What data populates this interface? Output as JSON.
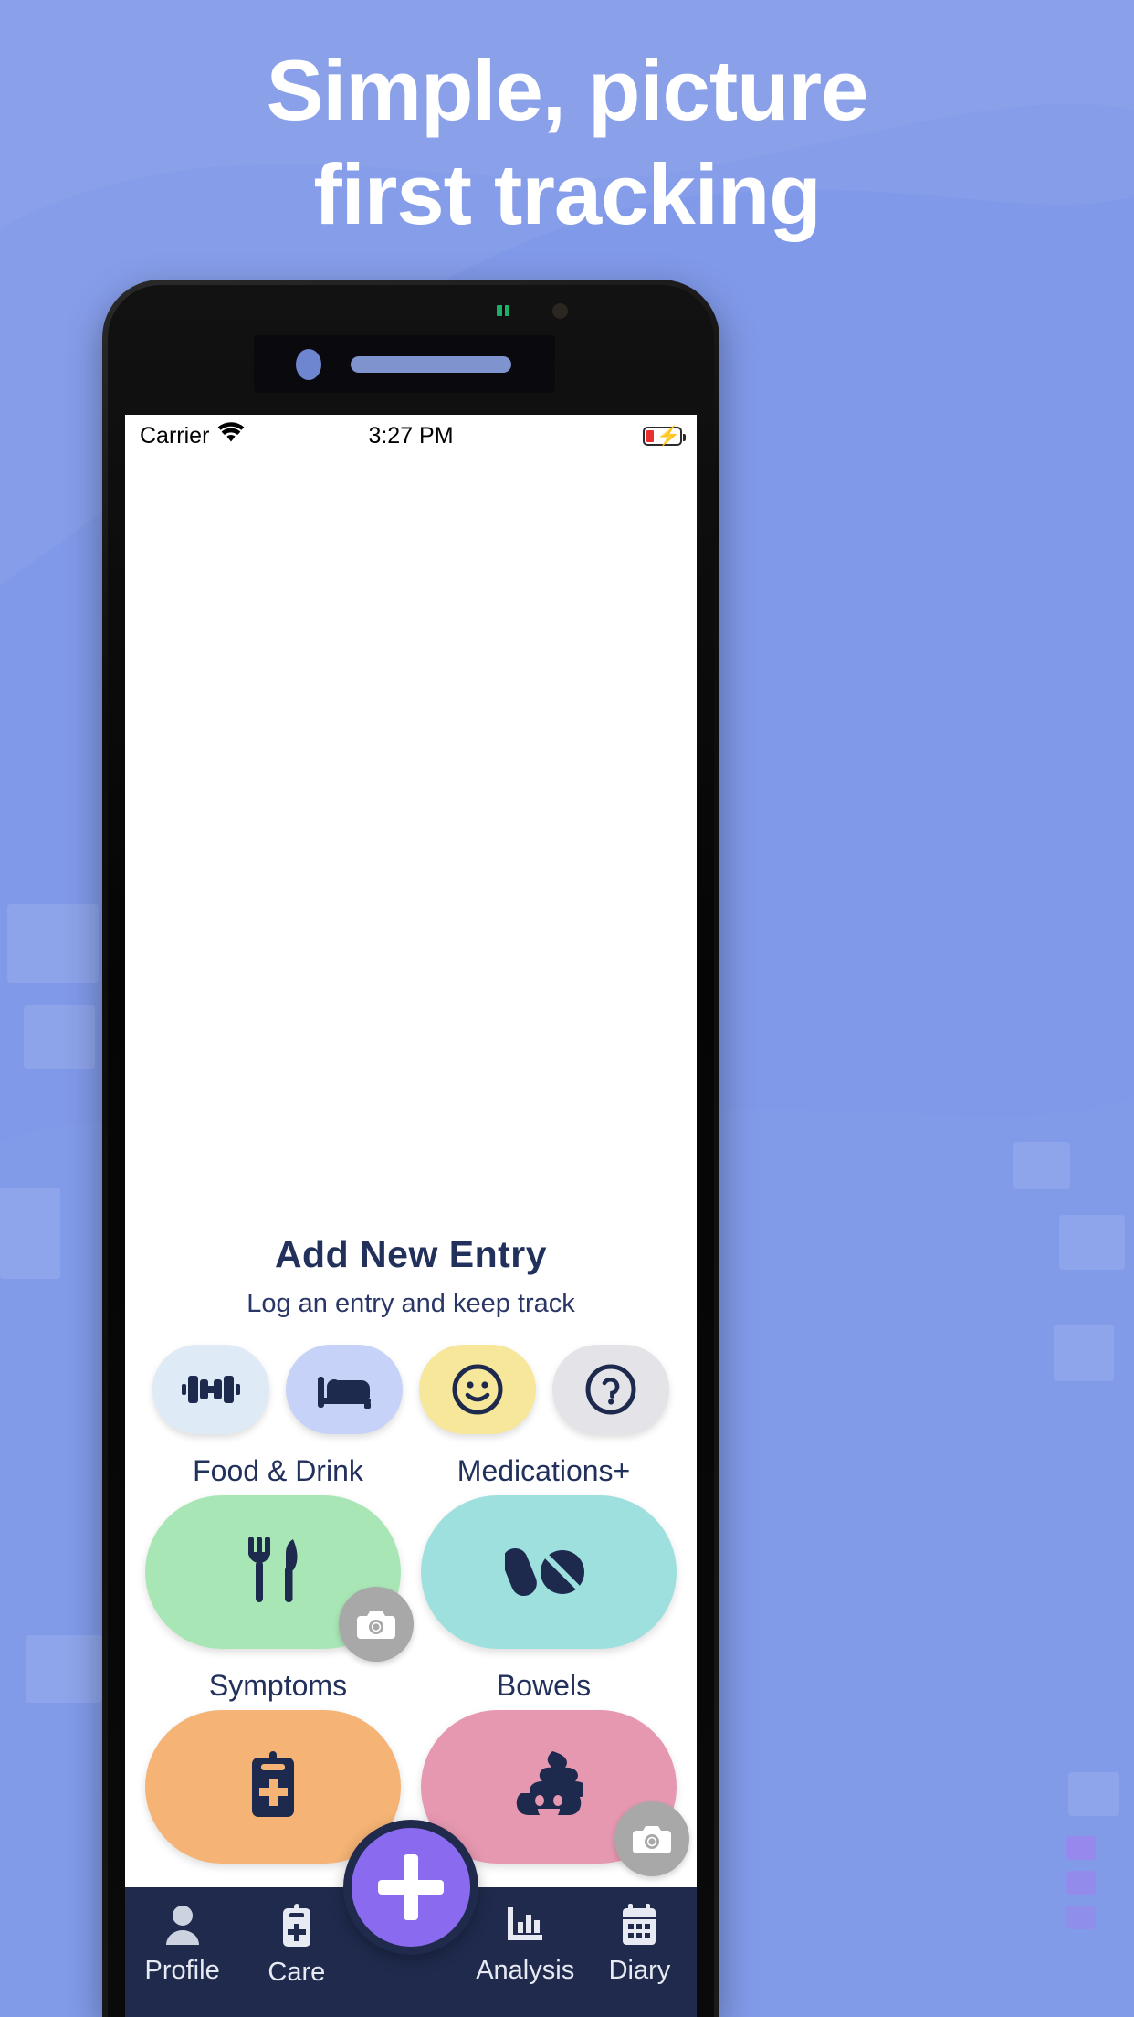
{
  "page": {
    "headline_line1": "Simple, picture",
    "headline_line2": "first tracking",
    "background_color": "#8099e8",
    "headline_color": "#ffffff"
  },
  "phone": {
    "status_bar": {
      "carrier": "Carrier",
      "wifi_icon": "wifi-icon",
      "time": "3:27 PM",
      "battery_icon": "battery-charging-low-icon"
    }
  },
  "app": {
    "title": "Add New Entry",
    "subtitle": "Log an entry and keep track",
    "accent_color": "#8a6bf0",
    "text_color": "#22305c",
    "quick_actions": [
      {
        "name": "exercise",
        "icon": "dumbbell-icon",
        "color": "#dfeaf7"
      },
      {
        "name": "sleep",
        "icon": "bed-icon",
        "color": "#c6d2f7"
      },
      {
        "name": "mood",
        "icon": "smiley-face-icon",
        "color": "#f7e79a"
      },
      {
        "name": "other",
        "icon": "question-mark-circle-icon",
        "color": "#e4e4e8"
      }
    ],
    "cards": [
      {
        "label": "Food & Drink",
        "icon": "fork-knife-icon",
        "color": "#a9e6b6",
        "camera_badge": true,
        "camera_icon": "camera-icon"
      },
      {
        "label": "Medications+",
        "icon": "pills-capsule-icon",
        "color": "#9de0dd",
        "camera_badge": false,
        "camera_icon": "camera-icon"
      },
      {
        "label": "Symptoms",
        "icon": "clipboard-medical-icon",
        "color": "#f5b375",
        "camera_badge": false,
        "camera_icon": "camera-icon"
      },
      {
        "label": "Bowels",
        "icon": "poop-icon",
        "color": "#e698b0",
        "camera_badge": true,
        "camera_icon": "camera-icon"
      }
    ],
    "tabbar": {
      "background_color": "#1f2a4d",
      "items": [
        {
          "label": "Profile",
          "icon": "person-icon"
        },
        {
          "label": "Care",
          "icon": "clipboard-medical-icon"
        },
        {
          "label": "",
          "icon": "plus-icon"
        },
        {
          "label": "Analysis",
          "icon": "bar-chart-icon"
        },
        {
          "label": "Diary",
          "icon": "calendar-icon"
        }
      ],
      "fab": {
        "icon": "plus-icon",
        "color": "#8a6bf0"
      }
    }
  }
}
